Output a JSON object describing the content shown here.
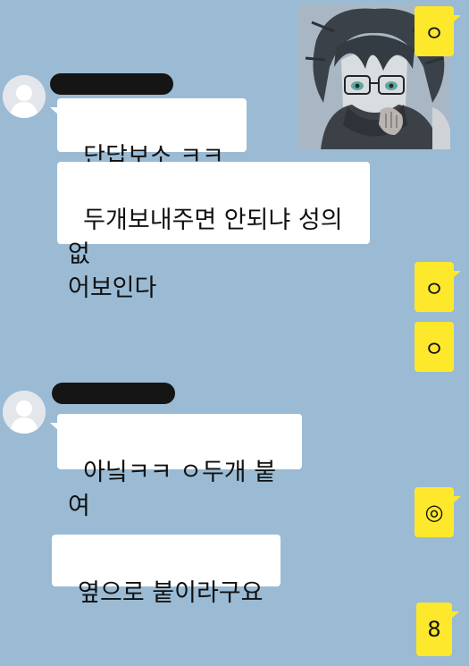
{
  "colors": {
    "background": "#9bbbd4",
    "incoming_bubble": "#ffffff",
    "outgoing_bubble": "#fde82c",
    "name_redaction": "#151515"
  },
  "messages": {
    "incoming_1a": "단답보소 ㅋㅋㅋ",
    "incoming_1b": "두개보내주면 안되냐 성의없\n어보인다",
    "incoming_2a": "아닠ㅋㅋ ㅇ두개 붙여",
    "incoming_2b": "옆으로 붙이라구요"
  },
  "replies": {
    "r1": "ㅇ",
    "r2": "ㅇ",
    "r3": "ㅇ",
    "r4": "◎",
    "r5": "8"
  },
  "icons": {
    "avatar": "default-profile-icon",
    "sticker": "anime-character-sticker"
  }
}
